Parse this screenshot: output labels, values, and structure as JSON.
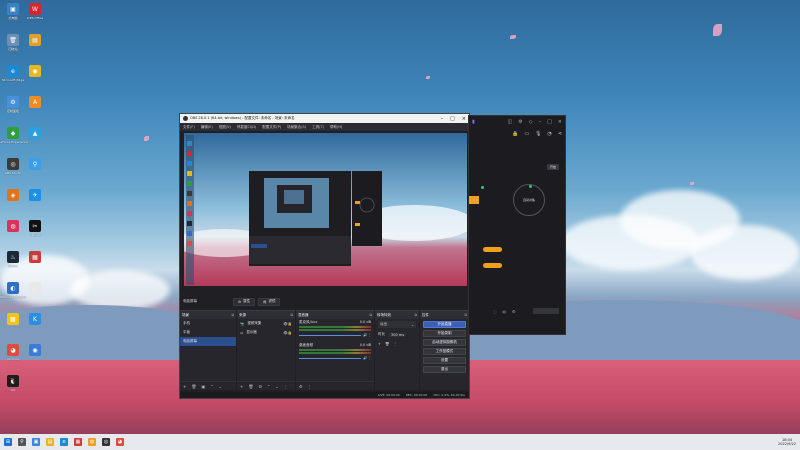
{
  "desktop": {
    "icons": [
      {
        "label": "此电脑",
        "color": "#3b82c4",
        "glyph": "▣"
      },
      {
        "label": "WPS Office",
        "color": "#d9242b",
        "glyph": "W"
      },
      {
        "label": "回收站",
        "color": "#6b8fb5",
        "glyph": "🗑"
      },
      {
        "label": "",
        "color": "#e0a030",
        "glyph": "▤"
      },
      {
        "label": "Microsoft Edge",
        "color": "#1a8ad4",
        "glyph": "e"
      },
      {
        "label": "",
        "color": "#e4b820",
        "glyph": "◉"
      },
      {
        "label": "控制面板",
        "color": "#4a90d9",
        "glyph": "⚙"
      },
      {
        "label": "",
        "color": "#f08a24",
        "glyph": "A"
      },
      {
        "label": "GeForce Experience",
        "color": "#2e9e3e",
        "glyph": "◆"
      },
      {
        "label": "",
        "color": "#2aa0e0",
        "glyph": "▲"
      },
      {
        "label": "OBS Studio",
        "color": "#3a3a3a",
        "glyph": "◎"
      },
      {
        "label": "",
        "color": "#3b9ee8",
        "glyph": "⚲"
      },
      {
        "label": "",
        "color": "#e2731a",
        "glyph": "◈"
      },
      {
        "label": "",
        "color": "#1c8fe6",
        "glyph": "✈"
      },
      {
        "label": "",
        "color": "#d8335a",
        "glyph": "◍"
      },
      {
        "label": "CapCut",
        "color": "#111111",
        "glyph": "✂"
      },
      {
        "label": "Steam",
        "color": "#1b2838",
        "glyph": "♨"
      },
      {
        "label": "",
        "color": "#c83c3c",
        "glyph": "▦"
      },
      {
        "label": "Wallpaper Engine",
        "color": "#2c6ec9",
        "glyph": "◐"
      },
      {
        "label": "",
        "color": "#e8e8e8",
        "glyph": "◌"
      },
      {
        "label": "",
        "color": "#f0c419",
        "glyph": "▩"
      },
      {
        "label": "",
        "color": "#2a8fe0",
        "glyph": "K"
      },
      {
        "label": "Chrome",
        "color": "#e04a3a",
        "glyph": "◕"
      },
      {
        "label": "",
        "color": "#3a7bd5",
        "glyph": "◉"
      },
      {
        "label": "QQ",
        "color": "#1d1d1d",
        "glyph": "🐧"
      }
    ]
  },
  "obs": {
    "title": "OBS 28.0.1 (64-bit, windows) - 配置文件: 未命名 - 场景: 未命名",
    "menu": [
      "文件(F)",
      "编辑(E)",
      "视图(V)",
      "停靠窗口(D)",
      "配置文件(P)",
      "场景集合(S)",
      "工具(T)",
      "帮助(H)"
    ],
    "scene_label": "电脑屏幕",
    "props_button": "属性",
    "filters_button": "滤镜",
    "docks": {
      "scenes": {
        "title": "场景",
        "items": [
          "手机",
          "平板",
          "电脑屏幕"
        ],
        "selected": 2
      },
      "sources": {
        "title": "来源",
        "items": [
          {
            "icon": "📷",
            "name": "视频采集"
          },
          {
            "icon": "▭",
            "name": "显示器"
          }
        ]
      },
      "mixer": {
        "title": "混音器",
        "channels": [
          {
            "name": "麦克风/Aux",
            "level": "0.0 dB"
          },
          {
            "name": "桌面音频",
            "level": "0.0 dB"
          }
        ]
      },
      "transitions": {
        "title": "转场特效",
        "type": "淡出",
        "duration_label": "时长",
        "duration": "300 ms"
      },
      "controls": {
        "title": "控件",
        "buttons": [
          "开始直播",
          "开始录制",
          "启动虚拟摄像机",
          "工作室模式",
          "设置",
          "退出"
        ],
        "primary": 0
      }
    },
    "status": {
      "live": "LIVE: 00:00:00",
      "rec": "REC: 00:00:00",
      "cpu": "CPU: 0.4%, 60.00 fps"
    }
  },
  "app2": {
    "ring_label": "自动对焦",
    "pill_labels": [
      "",
      ""
    ],
    "tab_label": "开始"
  },
  "taskbar": {
    "time": "18:04",
    "date": "2022/9/22",
    "apps": [
      {
        "color": "#1a6fd1",
        "glyph": "⊞"
      },
      {
        "color": "#555555",
        "glyph": "⚲"
      },
      {
        "color": "#3a86e0",
        "glyph": "▣"
      },
      {
        "color": "#e8b322",
        "glyph": "▤"
      },
      {
        "color": "#1a8ad4",
        "glyph": "e"
      },
      {
        "color": "#d33a3a",
        "glyph": "▦"
      },
      {
        "color": "#f0a020",
        "glyph": "◍"
      },
      {
        "color": "#333333",
        "glyph": "◎"
      },
      {
        "color": "#e04a3a",
        "glyph": "◕"
      }
    ]
  }
}
